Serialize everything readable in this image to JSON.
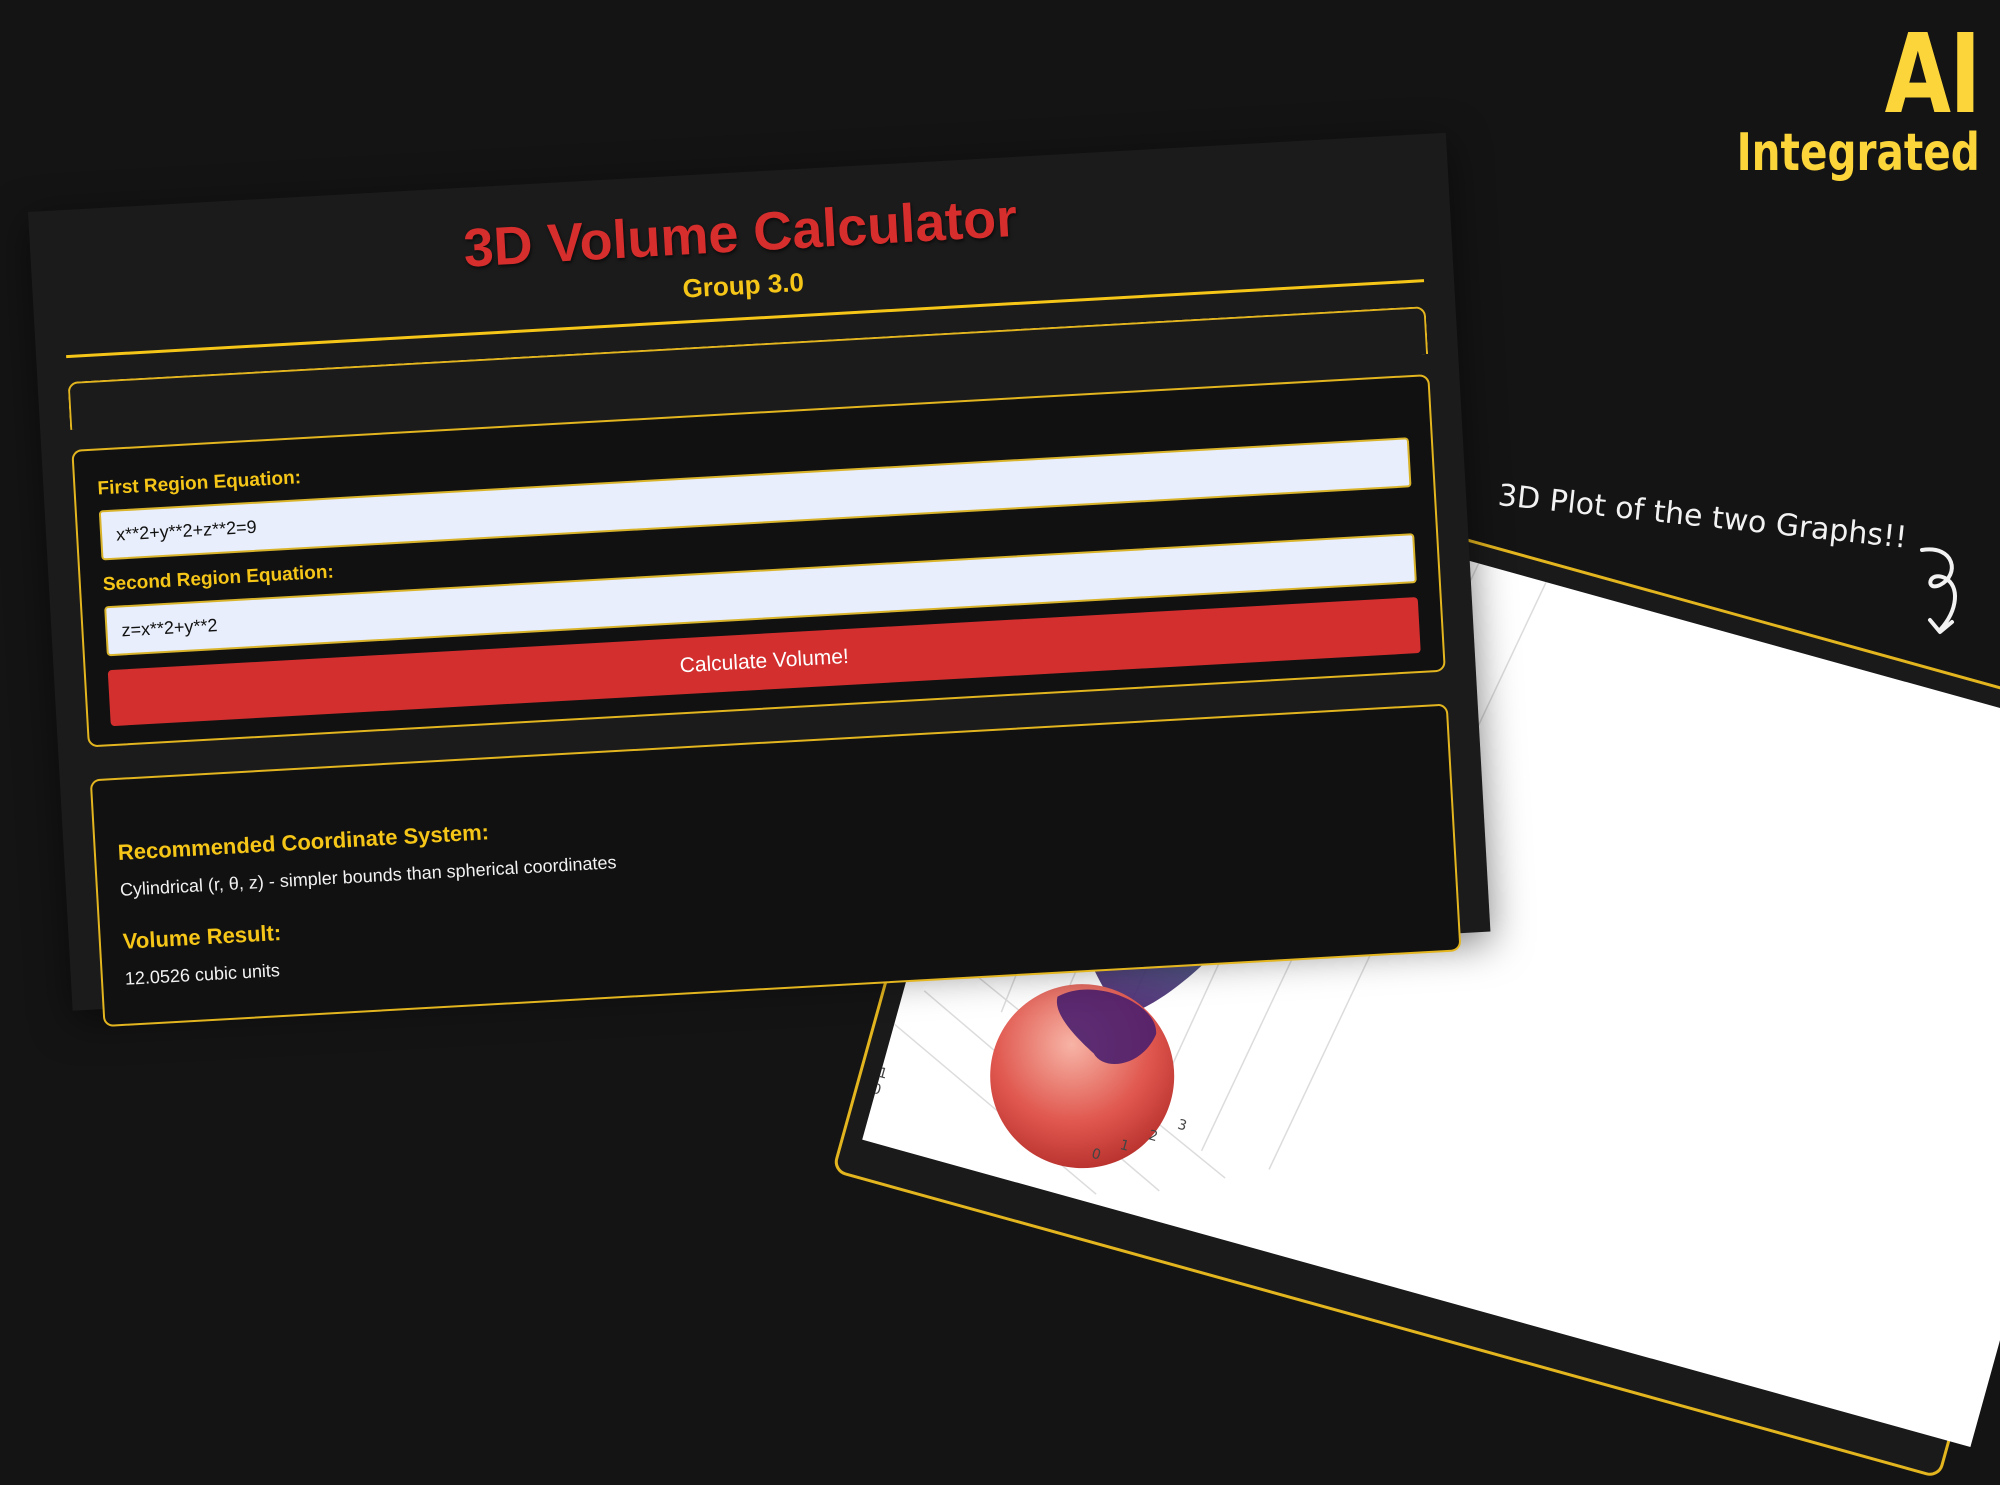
{
  "brand": {
    "ai": "AI",
    "integrated": "Integrated"
  },
  "calculator": {
    "title": "3D Volume Calculator",
    "subtitle": "Group 3.0",
    "first_region_label": "First Region Equation:",
    "first_region_value": "x**2+y**2+z**2=9",
    "second_region_label": "Second Region Equation:",
    "second_region_value": "z=x**2+y**2",
    "button_label": "Calculate Volume!",
    "coord_heading": "Recommended Coordinate System:",
    "coord_text": "Cylindrical (r, θ, z) - simpler bounds than spherical coordinates",
    "volume_heading": "Volume Result:",
    "volume_text": "12.0526 cubic units"
  },
  "plot": {
    "caption": "3D Plot of the two Graphs!!",
    "axis_ticks_left": [
      "0",
      "−3",
      "−2",
      "−1",
      "0"
    ],
    "axis_ticks_right": [
      "3",
      "2",
      "1",
      "0"
    ],
    "colors": {
      "sphere": "#e0584f",
      "paraboloid_top": "#b5d13a",
      "paraboloid_bottom": "#4b1f6e",
      "frame": "#e3b51f"
    }
  }
}
